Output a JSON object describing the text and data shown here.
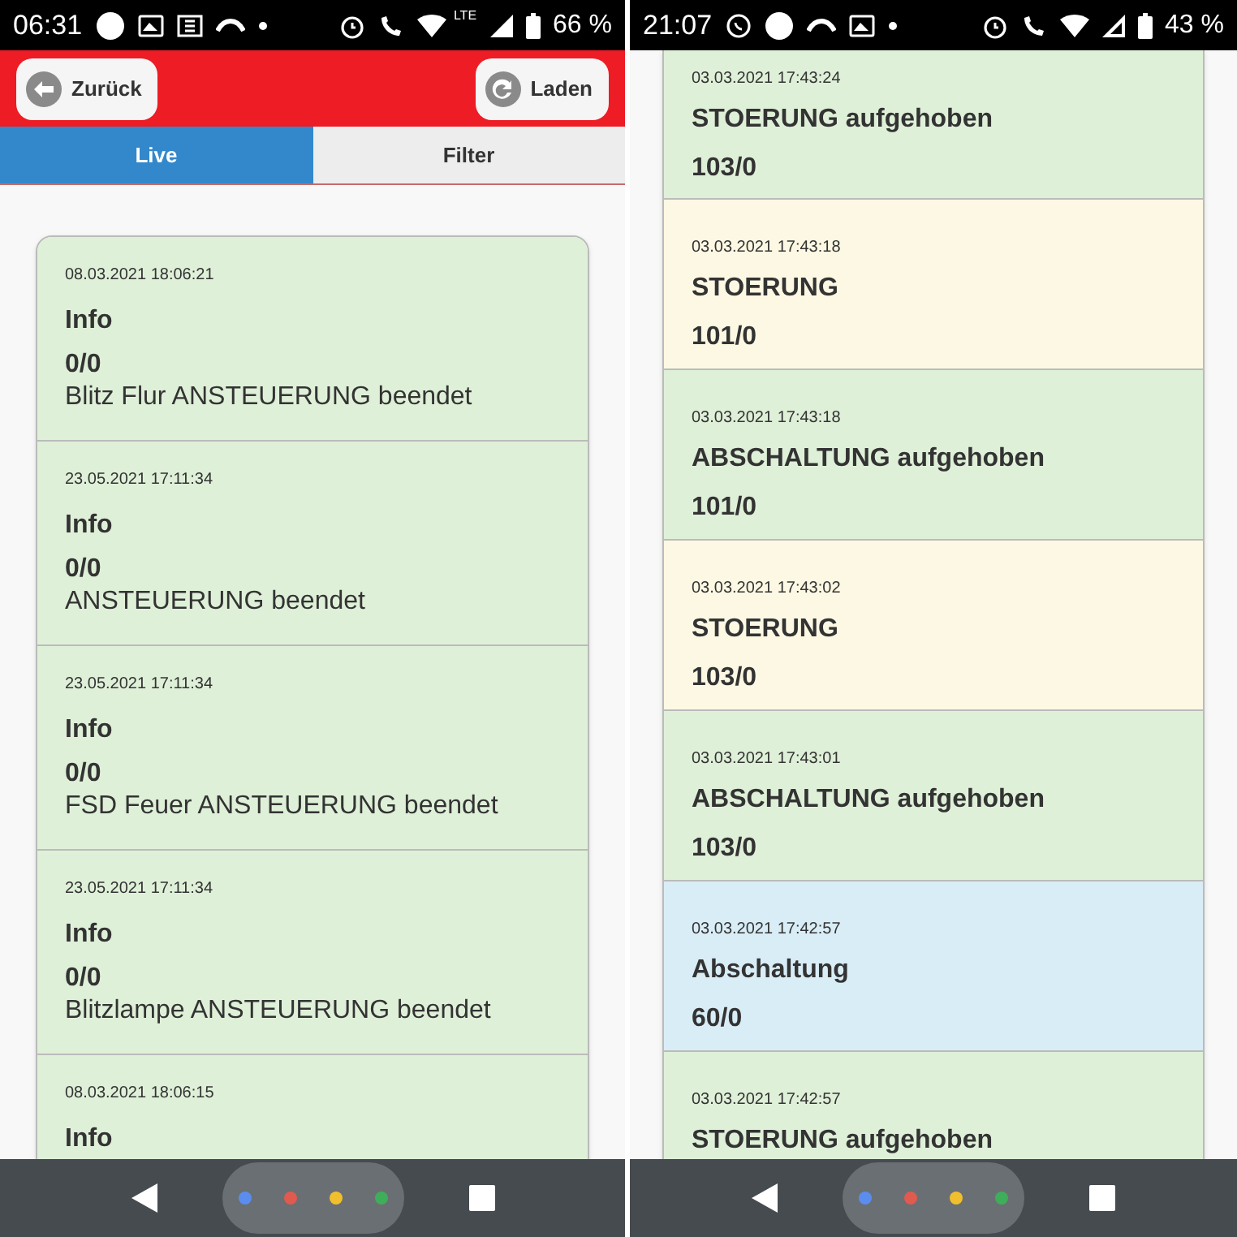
{
  "left_screen": {
    "status_bar": {
      "time": "06:31",
      "network": "LTE",
      "battery": "66 %"
    },
    "header": {
      "back_button": "Zurück",
      "reload_button": "Laden"
    },
    "tabs": [
      {
        "label": "Live",
        "selected": true
      },
      {
        "label": "Filter",
        "selected": false
      }
    ],
    "events": [
      {
        "date": "08.03.2021 18:06:21",
        "title": "Info",
        "code": "0/0",
        "message": "Blitz Flur ANSTEUERUNG beendet",
        "color": "#dff0d8"
      },
      {
        "date": "23.05.2021 17:11:34",
        "title": "Info",
        "code": "0/0",
        "message": "ANSTEUERUNG beendet",
        "color": "#dff0d8"
      },
      {
        "date": "23.05.2021 17:11:34",
        "title": "Info",
        "code": "0/0",
        "message": "FSD Feuer ANSTEUERUNG beendet",
        "color": "#dff0d8"
      },
      {
        "date": "23.05.2021 17:11:34",
        "title": "Info",
        "code": "0/0",
        "message": "Blitzlampe ANSTEUERUNG beendet",
        "color": "#dff0d8"
      },
      {
        "date": "08.03.2021 18:06:15",
        "title": "Info",
        "color": "#dff0d8"
      }
    ]
  },
  "right_screen": {
    "status_bar": {
      "time": "21:07",
      "battery": "43 %"
    },
    "events": [
      {
        "date": "03.03.2021 17:43:24",
        "title": "STOERUNG aufgehoben",
        "code": "103/0",
        "color": "#dff0d8"
      },
      {
        "date": "03.03.2021 17:43:18",
        "title": "STOERUNG",
        "code": "101/0",
        "color": "#fcf8e3"
      },
      {
        "date": "03.03.2021 17:43:18",
        "title": "ABSCHALTUNG aufgehoben",
        "code": "101/0",
        "color": "#dff0d8"
      },
      {
        "date": "03.03.2021 17:43:02",
        "title": "STOERUNG",
        "code": "103/0",
        "color": "#fcf8e3"
      },
      {
        "date": "03.03.2021 17:43:01",
        "title": "ABSCHALTUNG aufgehoben",
        "code": "103/0",
        "color": "#dff0d8"
      },
      {
        "date": "03.03.2021 17:42:57",
        "title": "Abschaltung",
        "code": "60/0",
        "color": "#d9edf7"
      },
      {
        "date": "03.03.2021 17:42:57",
        "title": "STOERUNG aufgehoben",
        "color": "#dff0d8"
      }
    ]
  }
}
